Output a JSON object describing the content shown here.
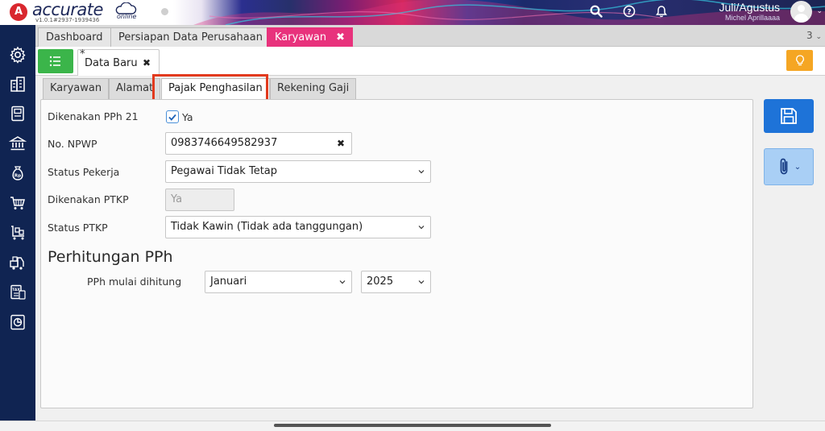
{
  "app": {
    "logo_text": "accurate",
    "logo_sub": "online",
    "version": "v1.0.1#2937-1939436"
  },
  "header": {
    "period": "Juli/Agustus",
    "user_name": "Michel Aprillaaaa",
    "icons": [
      "search-icon",
      "help-icon",
      "notification-bell-icon",
      "user-avatar"
    ]
  },
  "sidebar": {
    "icons": [
      "gear-icon",
      "building-icon",
      "ledger-book-icon",
      "bank-icon",
      "money-bag-icon",
      "shopping-cart-icon",
      "cart-delivery-icon",
      "warehouse-forklift-icon",
      "tax-document-icon",
      "report-chart-icon"
    ]
  },
  "module_tabs": {
    "items": [
      {
        "label": "Dashboard",
        "active": false
      },
      {
        "label": "Persiapan Data Perusahaan",
        "active": false
      },
      {
        "label": "Karyawan",
        "active": true
      }
    ],
    "close_symbol": "✖",
    "count": "3"
  },
  "data_tab": {
    "modified_marker": "*",
    "label": "Data Baru",
    "close_symbol": "✖"
  },
  "sub_tabs": {
    "items": [
      {
        "label": "Karyawan",
        "active": false
      },
      {
        "label": "Alamat",
        "active": false
      },
      {
        "label": "Pajak Penghasilan",
        "active": true
      },
      {
        "label": "Rekening Gaji",
        "active": false
      }
    ]
  },
  "form": {
    "pph21_label": "Dikenakan PPh 21",
    "pph21_checked": true,
    "pph21_value_label": "Ya",
    "npwp_label": "No. NPWP",
    "npwp_value": "0983746649582937",
    "npwp_clear": "✖",
    "status_pekerja_label": "Status Pekerja",
    "status_pekerja_value": "Pegawai Tidak Tetap",
    "ptkp_label": "Dikenakan PTKP",
    "ptkp_value": "Ya",
    "status_ptkp_label": "Status PTKP",
    "status_ptkp_value": "Tidak Kawin (Tidak ada tanggungan)"
  },
  "pph_section": {
    "title": "Perhitungan PPh",
    "start_label": "PPh mulai dihitung",
    "month_value": "Januari",
    "year_value": "2025"
  },
  "actions": {
    "save_icon": "floppy-disk-icon",
    "attach_icon": "paperclip-icon"
  },
  "colors": {
    "sidebar_bg": "#102452",
    "active_module_tab": "#e8327c",
    "list_button": "#3bb54a",
    "bulb_button": "#f5a623",
    "save_button": "#1e73d8",
    "attach_button": "#a9cff5",
    "highlight_box": "#e23a1e"
  }
}
